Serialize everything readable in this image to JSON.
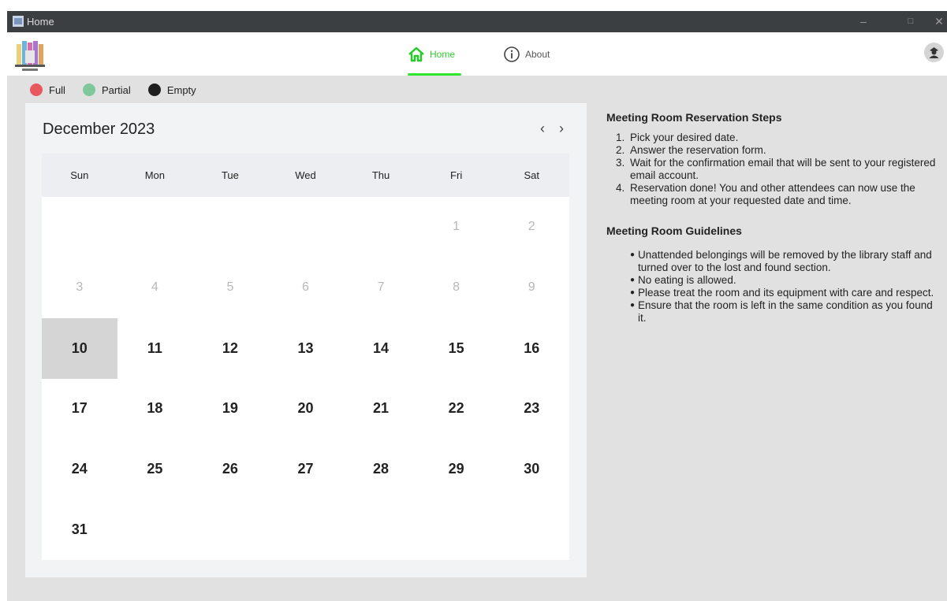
{
  "window": {
    "title": "Home",
    "minimize": "–",
    "maximize": "□",
    "close": "✕"
  },
  "nav": {
    "home_label": "Home",
    "about_label": "About"
  },
  "legend": [
    {
      "label": "Full",
      "color": "#e8585f"
    },
    {
      "label": "Partial",
      "color": "#7ec89c"
    },
    {
      "label": "Empty",
      "color": "#1e1e1e"
    }
  ],
  "calendar": {
    "month_label": "December 2023",
    "prev": "‹",
    "next": "›",
    "weekdays": [
      "Sun",
      "Mon",
      "Tue",
      "Wed",
      "Thu",
      "Fri",
      "Sat"
    ],
    "days": [
      "",
      "",
      "",
      "",
      "",
      "1",
      "2",
      "3",
      "4",
      "5",
      "6",
      "7",
      "8",
      "9",
      "10",
      "11",
      "12",
      "13",
      "14",
      "15",
      "16",
      "17",
      "18",
      "19",
      "20",
      "21",
      "22",
      "23",
      "24",
      "25",
      "26",
      "27",
      "28",
      "29",
      "30",
      "31",
      "",
      "",
      "",
      "",
      "",
      ""
    ],
    "muted_until": 9,
    "selected_day": "10"
  },
  "info": {
    "steps_title": "Meeting Room Reservation Steps",
    "steps": [
      "Pick your desired date.",
      "Answer the reservation form.",
      "Wait for the confirmation email that will be sent to your registered email account.",
      "Reservation done! You and other attendees can now use the meeting room at your requested date and time."
    ],
    "guidelines_title": "Meeting Room Guidelines",
    "guidelines": [
      "Unattended belongings will be removed by the library staff and turned over to the lost and found section.",
      "No eating is allowed.",
      "Please treat the room and its equipment with care and respect.",
      "Ensure that the room is left in the same condition as you found it."
    ]
  }
}
